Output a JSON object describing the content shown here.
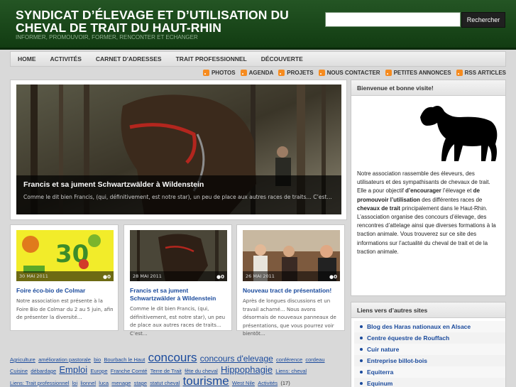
{
  "header": {
    "title": "SYNDICAT D’ÉLEVAGE ET D’UTILISATION DU CHEVAL DE TRAIT DU HAUT-RHIN",
    "tagline": "INFORMER, PROMOUVOIR, FORMER, RENCONTER ET ECHANGER",
    "search_button": "Rechercher"
  },
  "nav": {
    "items": [
      "HOME",
      "ACTIVITÉS",
      "CARNET D'ADRESSES",
      "TRAIT PROFESSIONNEL",
      "DÉCOUVERTE"
    ]
  },
  "sublinks": [
    "PHOTOS",
    "AGENDA",
    "PROJETS",
    "NOUS CONTACTER",
    "PETITES ANNONCES",
    "RSS ARTICLES"
  ],
  "featured": {
    "title": "Francis et sa jument Schwartzwälder à Wildenstein",
    "excerpt": "Comme le dit bien Francis, (qui, définitivement, est notre star), un peu de place aux autres races de traits… C’est…"
  },
  "posts": [
    {
      "date": "30 MAI 2011",
      "comments": "0",
      "title": "Foire éco-bio de Colmar",
      "excerpt": "Notre association est présente à la Foire Bio de Colmar du 2 au 5 juin, afin de présenter la diversité…"
    },
    {
      "date": "28 MAI 2011",
      "comments": "0",
      "title": "Francis et sa jument Schwartzwälder à Wildenstein",
      "excerpt": "Comme le dit bien Francis, (qui, définitivement, est notre star), un peu de place aux autres races de traits… C’est…"
    },
    {
      "date": "26 MAI 2011",
      "comments": "0",
      "title": "Nouveau tract de présentation!",
      "excerpt": "Après de longues discussions et un travail acharné… Nous avons désormais de nouveaux panneaux de présentations, que vous pourrez voir bientôt…"
    }
  ],
  "tags": [
    {
      "label": "Agriculture",
      "size": 7.5
    },
    {
      "label": "amélioration pastorale",
      "size": 7.5
    },
    {
      "label": "bio",
      "size": 7.5
    },
    {
      "label": "Bourbach le Haut",
      "size": 7.5
    },
    {
      "label": "concours",
      "size": 17
    },
    {
      "label": "concours d'elevage",
      "size": 12
    },
    {
      "label": "conférence",
      "size": 7.5
    },
    {
      "label": "cordeau",
      "size": 7.5
    },
    {
      "label": "Cuisine",
      "size": 7.5
    },
    {
      "label": "débardage",
      "size": 7.5
    },
    {
      "label": "Emploi",
      "size": 13
    },
    {
      "label": "Europe",
      "size": 7.5
    },
    {
      "label": "Franche Comté",
      "size": 7.5
    },
    {
      "label": "Terre de Trait",
      "size": 7.5
    },
    {
      "label": "fête du cheval",
      "size": 7.5
    },
    {
      "label": "Hippophagie",
      "size": 13
    },
    {
      "label": "Liens: cheval",
      "size": 7.5
    },
    {
      "label": "Liens: Trait professionnel",
      "size": 7.5
    },
    {
      "label": "loi",
      "size": 7.5
    },
    {
      "label": "lionnel",
      "size": 7.5
    },
    {
      "label": "luca",
      "size": 7.5
    },
    {
      "label": "menage",
      "size": 7.5
    },
    {
      "label": "stage",
      "size": 7.5
    },
    {
      "label": "statut cheval",
      "size": 7.5
    },
    {
      "label": "tourisme",
      "size": 17
    },
    {
      "label": "West Nile",
      "size": 7.5
    },
    {
      "label": "Activités",
      "size": 7.5
    }
  ],
  "tag_extra": "(17)",
  "sidebar": {
    "welcome_title": "Bienvenue et bonne visite!",
    "welcome_text_html_parts": [
      "Notre association rassemble des éleveurs, des utilisateurs et des sympathisants de chevaux de trait. Elle a pour objectif ",
      "d’encourager",
      " l’élevage et ",
      "de promouvoir l’utilisation",
      " des différentes races de ",
      "chevaux de trait",
      " principalement dans le Haut-Rhin. L’association organise des concours d’élevage, des rencontres d’attelage ainsi que diverses formations à la traction animale. Vous trouverez sur ce site des informations sur l’actualité du cheval de trait et de la traction animale."
    ],
    "links_title": "Liens vers d’autres sites",
    "links": [
      "Blog des Haras nationaux en Alsace",
      "Centre équestre de Rouffach",
      "Cuir nature",
      "Entreprise billot-bois",
      "Equiterra",
      "Equinum"
    ]
  },
  "colors": {
    "header_bg": "#1d4a1d",
    "link": "#1a4a9c",
    "rss": "#f68b1f"
  }
}
